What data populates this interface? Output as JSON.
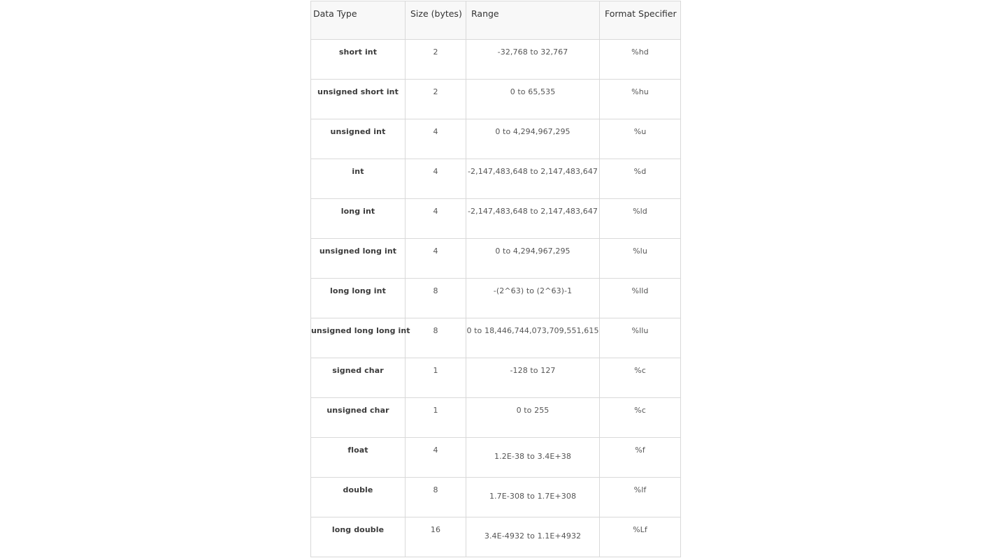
{
  "headers": [
    "Data Type",
    "Size (bytes)",
    "Range",
    "Format Specifier"
  ],
  "rows": [
    {
      "type": "short int",
      "size": "2",
      "range": "-32,768 to 32,767",
      "format": "%hd"
    },
    {
      "type": "unsigned short int",
      "size": "2",
      "range": "0 to 65,535",
      "format": "%hu"
    },
    {
      "type": "unsigned int",
      "size": "4",
      "range": "0 to 4,294,967,295",
      "format": "%u"
    },
    {
      "type": "int",
      "size": "4",
      "range": "-2,147,483,648 to 2,147,483,647",
      "format": "%d"
    },
    {
      "type": "long int",
      "size": "4",
      "range": "-2,147,483,648 to 2,147,483,647",
      "format": "%ld"
    },
    {
      "type": "unsigned long int",
      "size": "4",
      "range": "0 to 4,294,967,295",
      "format": "%lu"
    },
    {
      "type": "long long int",
      "size": "8",
      "range": "-(2^63) to (2^63)-1",
      "format": "%lld"
    },
    {
      "type": "unsigned long long int",
      "size": "8",
      "range": "0 to 18,446,744,073,709,551,615",
      "format": "%llu"
    },
    {
      "type": "signed char",
      "size": "1",
      "range": "-128 to 127",
      "format": "%c"
    },
    {
      "type": "unsigned char",
      "size": "1",
      "range": "0 to 255",
      "format": "%c"
    },
    {
      "type": "float",
      "size": "4",
      "range": "1.2E-38 to 3.4E+38",
      "format": "%f"
    },
    {
      "type": "double",
      "size": "8",
      "range": "1.7E-308 to 1.7E+308",
      "format": "%lf"
    },
    {
      "type": "long double",
      "size": "16",
      "range": "3.4E-4932 to 1.1E+4932",
      "format": "%Lf"
    }
  ]
}
